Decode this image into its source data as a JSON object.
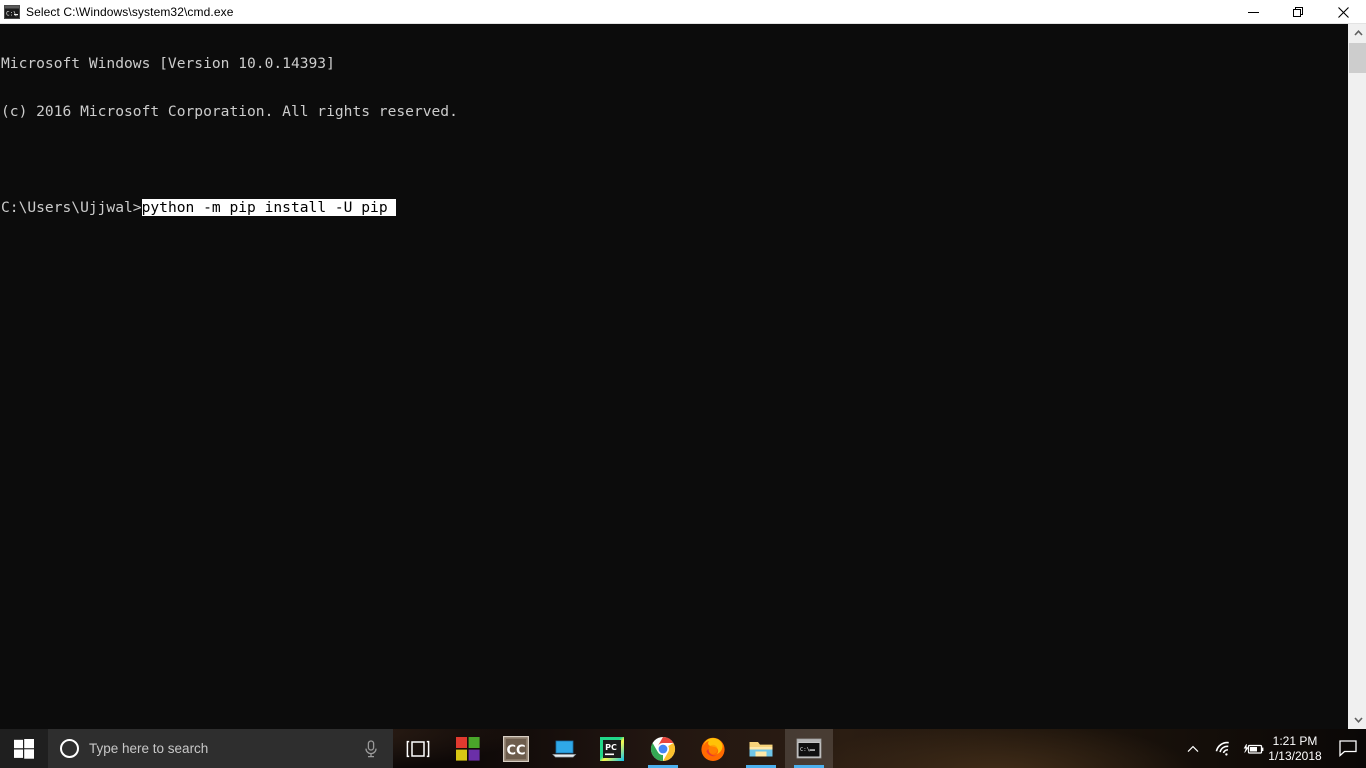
{
  "window": {
    "title": "Select C:\\Windows\\system32\\cmd.exe",
    "icon": "cmd-icon",
    "controls": {
      "minimize_label": "Minimize",
      "restore_label": "Restore",
      "close_label": "Close"
    }
  },
  "console": {
    "background": "#0c0c0c",
    "foreground": "#cccccc",
    "lines": [
      {
        "text": "Microsoft Windows [Version 10.0.14393]",
        "selected": false
      },
      {
        "text": "(c) 2016 Microsoft Corporation. All rights reserved.",
        "selected": false
      },
      {
        "text": "",
        "selected": false
      },
      {
        "text": "",
        "selected": false
      }
    ],
    "prompt": "C:\\Users\\Ujjwal>",
    "command": "python -m pip install -U pip ",
    "selection_bg": "#ffffff",
    "selection_fg": "#000000"
  },
  "scrollbar": {
    "up_arrow": "chevron-up-icon",
    "down_arrow": "chevron-down-icon",
    "track_color": "#f0f0f0",
    "thumb_color": "#cdcdcd"
  },
  "taskbar": {
    "start_label": "Start",
    "search": {
      "placeholder": "Type here to search",
      "cortana_icon": "cortana-circle-icon",
      "mic_icon": "microphone-icon"
    },
    "task_view_label": "Task View",
    "apps": [
      {
        "name": "microsoft-store",
        "label": "Microsoft Store",
        "running": false,
        "active": false
      },
      {
        "name": "ccleaner",
        "label": "CCleaner",
        "running": false,
        "active": false
      },
      {
        "name": "connect-laptop",
        "label": "Connect",
        "running": false,
        "active": false
      },
      {
        "name": "pycharm",
        "label": "PyCharm",
        "running": false,
        "active": false
      },
      {
        "name": "google-chrome",
        "label": "Google Chrome",
        "running": true,
        "active": false
      },
      {
        "name": "mozilla-firefox",
        "label": "Mozilla Firefox",
        "running": false,
        "active": false
      },
      {
        "name": "file-explorer",
        "label": "File Explorer",
        "running": true,
        "active": false
      },
      {
        "name": "command-prompt",
        "label": "Command Prompt",
        "running": true,
        "active": true
      }
    ],
    "tray": {
      "show_hidden_icons": "chevron-up-icon",
      "network": "wifi-icon",
      "battery": "battery-charging-icon",
      "time": "1:21 PM",
      "date": "1/13/2018",
      "action_center": "action-center-icon"
    },
    "accent_color": "#4cb0ee"
  }
}
